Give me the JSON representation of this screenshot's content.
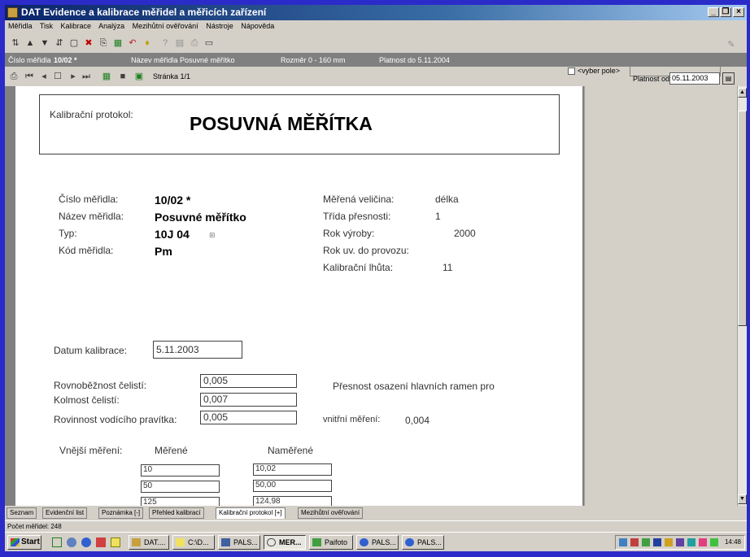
{
  "window": {
    "title": "DAT Evidence a kalibrace měřidel a měřicích zařízení",
    "controls": [
      "_",
      "ő",
      "×"
    ]
  },
  "menu": [
    "Měřidla",
    "Tisk",
    "Kalibrace",
    "Analýza",
    "Mezihůtní ověřování",
    "Nástroje",
    "Nápověda"
  ],
  "toolbar": {
    "select_field_label": "<vyber pole>",
    "select_field_value": ""
  },
  "infobar": {
    "cislo_label": "Číslo měřidla",
    "cislo_value": "10/02 *",
    "nazev": "Název měřidla Posuvné měřítko",
    "rozmer": "Rozměr 0 - 160 mm",
    "platnost": "Platnost do 5.11.2004"
  },
  "navbar": {
    "page_label": "Stránka 1/1",
    "platnost_od_label": "Platnost od",
    "platnost_od_value": "05.11.2003"
  },
  "report": {
    "protocol_label": "Kalibrační protokol:",
    "protocol_title": "POSUVNÁ MĚŘÍTKA",
    "left": [
      {
        "label": "Číslo měřidla:",
        "value": "10/02 *"
      },
      {
        "label": "Název měřidla:",
        "value": "Posuvné měřítko"
      },
      {
        "label": "Typ:",
        "value": "10J 04"
      },
      {
        "label": "Kód měřidla:",
        "value": "Pm"
      }
    ],
    "right": [
      {
        "label": "Měřená veličina:",
        "value": "délka"
      },
      {
        "label": "Třída přesnosti:",
        "value": "1"
      },
      {
        "label": "Rok výroby:",
        "value": "2000"
      },
      {
        "label": "Rok uv. do provozu:",
        "value": ""
      },
      {
        "label": "Kalibrační lhůta:",
        "value": "11"
      }
    ],
    "datum_label": "Datum kalibrace:",
    "datum_value": "5.11.2003",
    "checks": [
      {
        "label": "Rovnoběžnost čelistí:",
        "value": "0,005"
      },
      {
        "label": "Kolmost čelistí:",
        "value": "0,007"
      },
      {
        "label": "Rovinnost vodícího pravítka:",
        "value": "0,005"
      }
    ],
    "presnost_text": "Přesnost osazení hlavních ramen pro",
    "vnitrni_label": "vnitřní měření:",
    "vnitrni_value": "0,004",
    "vnejsi_label": "Vnější měření:",
    "col_merene": "Měřené",
    "col_namerene": "Naměřené",
    "rows": [
      {
        "merene": "10",
        "namerene": "10,02"
      },
      {
        "merene": "50",
        "namerene": "50,00"
      },
      {
        "merene": "125",
        "namerene": "124,98"
      }
    ]
  },
  "tabs": [
    "Seznam",
    "Evidenční list",
    "Poznámka [-]",
    "Přehled kalibrací",
    "Kalibrační protokol [+]",
    "Mezihůtní ověřování"
  ],
  "active_tab": "Kalibrační protokol [+]",
  "status": "Počet měřidel: 248",
  "taskbar": {
    "start": "Start",
    "tasks": [
      "DAT....",
      "C:\\D...",
      "PALS...",
      "MER...",
      "Paifoto",
      "PALS...",
      "PALS..."
    ],
    "active_task": "MER...",
    "clock": "14:48"
  }
}
